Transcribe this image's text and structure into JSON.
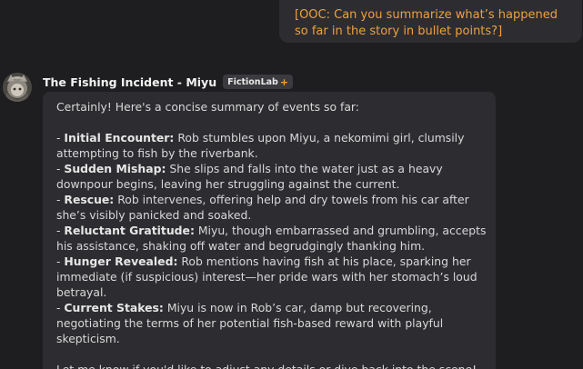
{
  "user_message": {
    "text": "[OOC: Can you summarize what’s happened so far in the story in bullet points?]"
  },
  "assistant": {
    "name": "The Fishing Incident - Miyu",
    "badge": "FictionLab",
    "badge_plus": "+",
    "intro": "Certainly! Here's a concise summary of events so far:",
    "bullets": [
      {
        "prefix": "- ",
        "title": "Initial Encounter:",
        "text": " Rob stumbles upon Miyu, a nekomimi girl, clumsily attempting to fish by the riverbank."
      },
      {
        "prefix": "- ",
        "title": "Sudden Mishap:",
        "text": " She slips and falls into the water just as a heavy downpour begins, leaving her struggling against the current."
      },
      {
        "prefix": "- ",
        "title": "Rescue:",
        "text": " Rob intervenes, offering help and dry towels from his car after she’s visibly panicked and soaked."
      },
      {
        "prefix": "- ",
        "title": "Reluctant Gratitude:",
        "text": " Miyu, though embarrassed and grumbling, accepts his assistance, shaking off water and begrudgingly thanking him."
      },
      {
        "prefix": "- ",
        "title": "Hunger Revealed:",
        "text": " Rob mentions having fish at his place, sparking her immediate (if suspicious) interest—her pride wars with her stomach’s loud betrayal."
      },
      {
        "prefix": "- ",
        "title": "Current Stakes:",
        "text": " Miyu is now in Rob’s car, damp but recovering, negotiating the terms of her potential fish-based reward with playful skepticism."
      }
    ],
    "closing": "Let me know if you'd like to adjust any details or dive back into the scene!"
  },
  "colors": {
    "background": "#1e1e20",
    "bubble": "#2d2d31",
    "accent": "#f0a03c",
    "text": "#d8d8d8"
  }
}
